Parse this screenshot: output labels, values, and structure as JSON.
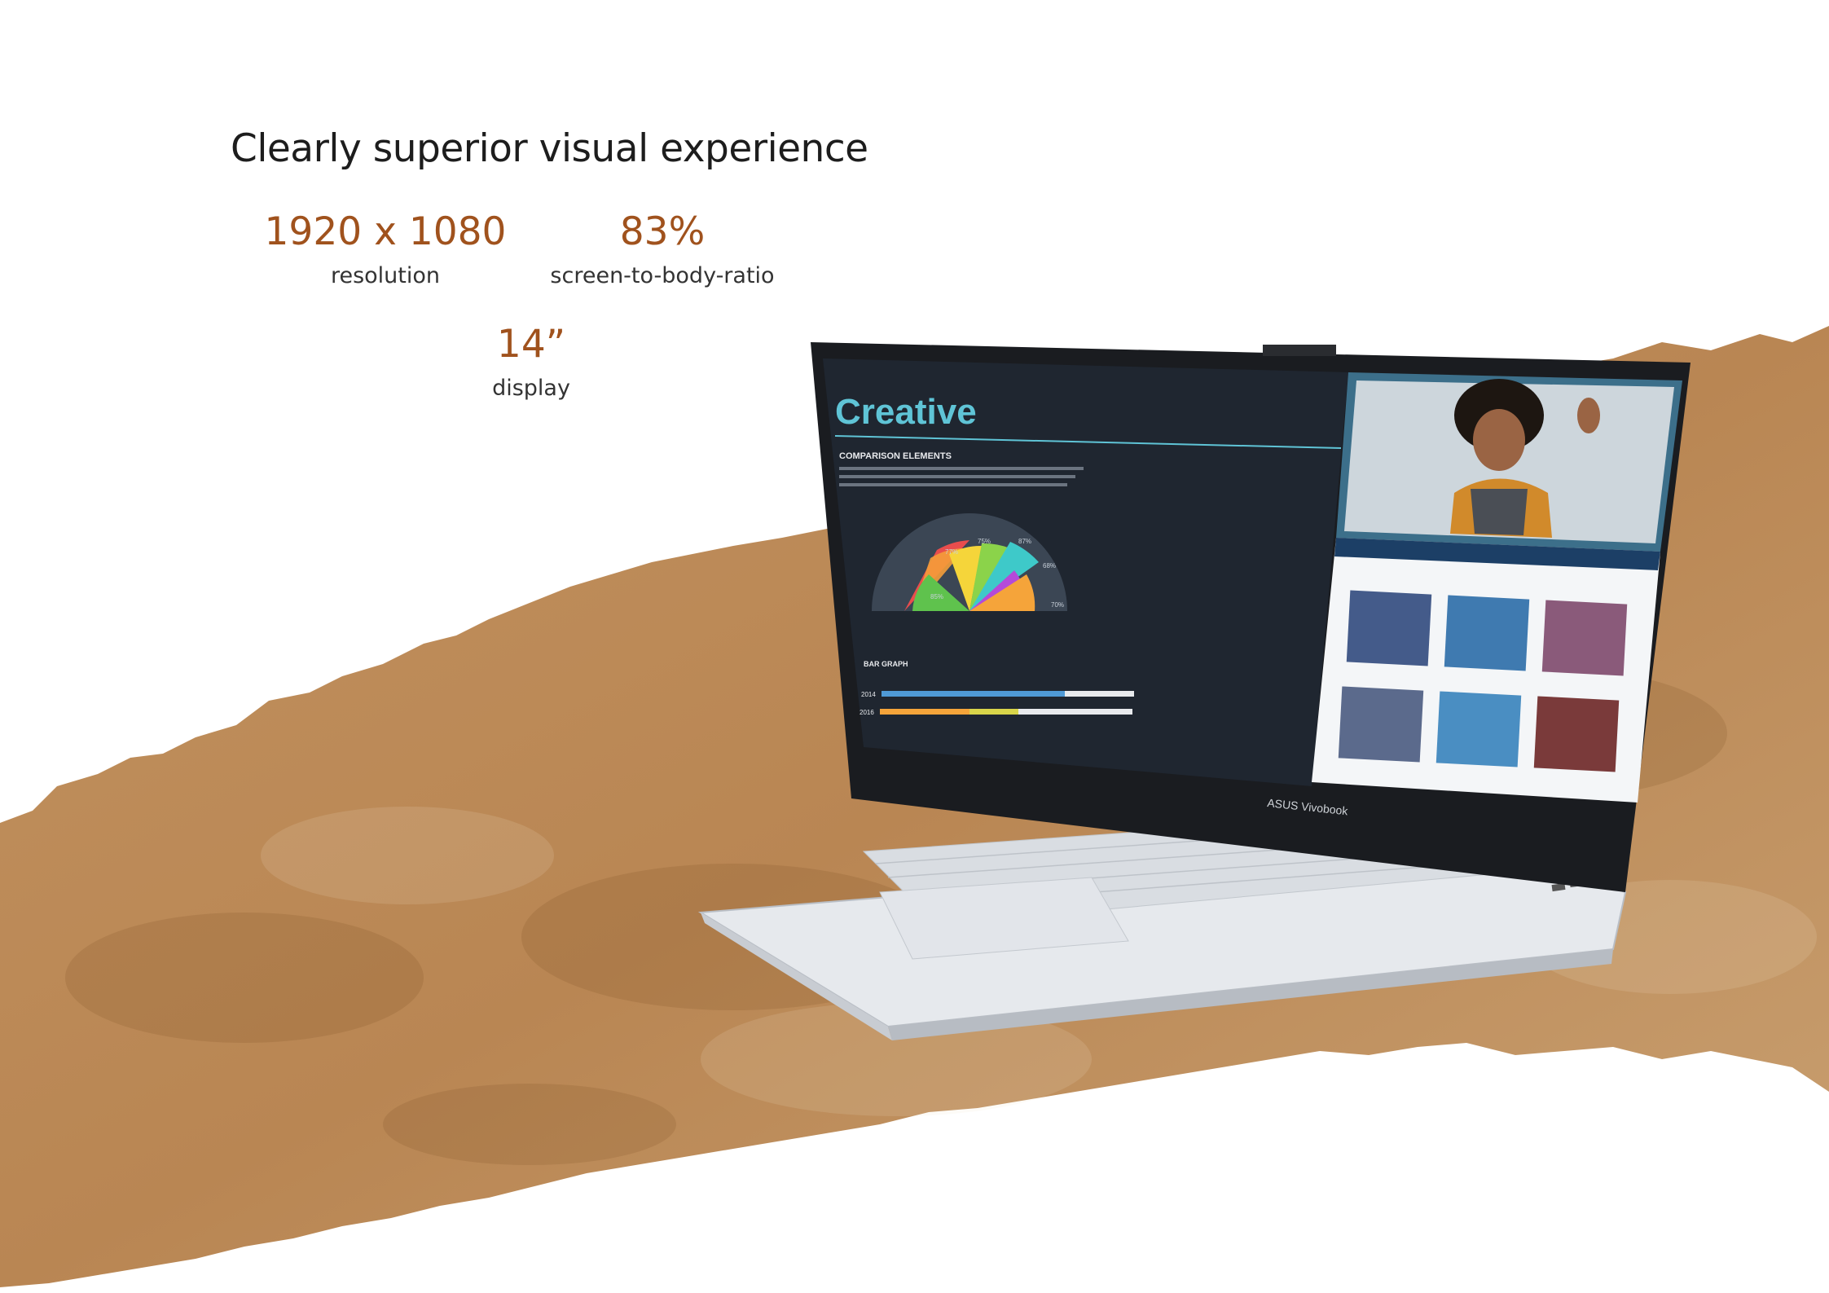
{
  "headline": "Clearly superior visual experience",
  "stats": [
    {
      "value": "1920 x 1080",
      "label": "resolution"
    },
    {
      "value": "83%",
      "label": "screen-to-body-ratio"
    },
    {
      "value": "14”",
      "label": "display"
    }
  ],
  "laptop": {
    "brand": "ASUS Vivobook",
    "screen": {
      "slide_title": "Creative",
      "section_1": "COMPARISON ELEMENTS",
      "section_2": "BAR GRAPH",
      "bar_years": [
        "2014",
        "2016"
      ],
      "gauge_labels": [
        "85%",
        "77%",
        "75%",
        "87%",
        "68%",
        "70%"
      ]
    }
  },
  "colors": {
    "accent_text": "#a0521d",
    "paper_brown": "#b98653",
    "paper_light": "#d2a87a",
    "screen_dark": "#1f2630",
    "laptop_silver": "#dfe3e8"
  }
}
